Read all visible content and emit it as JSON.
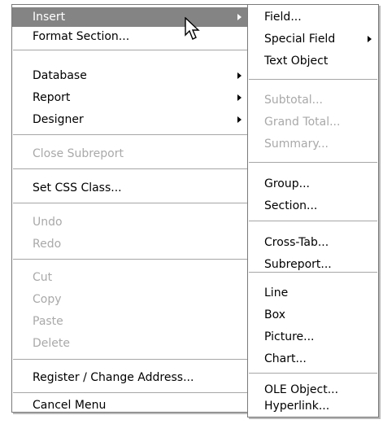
{
  "main_menu": {
    "insert": "Insert",
    "format_section": "Format Section...",
    "database": "Database",
    "report": "Report",
    "designer": "Designer",
    "close_subreport": "Close Subreport",
    "set_css_class": "Set CSS Class...",
    "undo": "Undo",
    "redo": "Redo",
    "cut": "Cut",
    "copy": "Copy",
    "paste": "Paste",
    "delete": "Delete",
    "register": "Register / Change Address...",
    "cancel_menu": "Cancel Menu"
  },
  "insert_submenu": {
    "field": "Field...",
    "special_field": "Special Field",
    "text_object": "Text Object",
    "subtotal": "Subtotal...",
    "grand_total": "Grand Total...",
    "summary": "Summary...",
    "group": "Group...",
    "section": "Section...",
    "cross_tab": "Cross-Tab...",
    "subreport": "Subreport...",
    "line": "Line",
    "box": "Box",
    "picture": "Picture...",
    "chart": "Chart...",
    "ole_object": "OLE Object...",
    "hyperlink": "Hyperlink..."
  },
  "colors": {
    "selected_bg": "#848484",
    "disabled_text": "#a9a9a9"
  }
}
